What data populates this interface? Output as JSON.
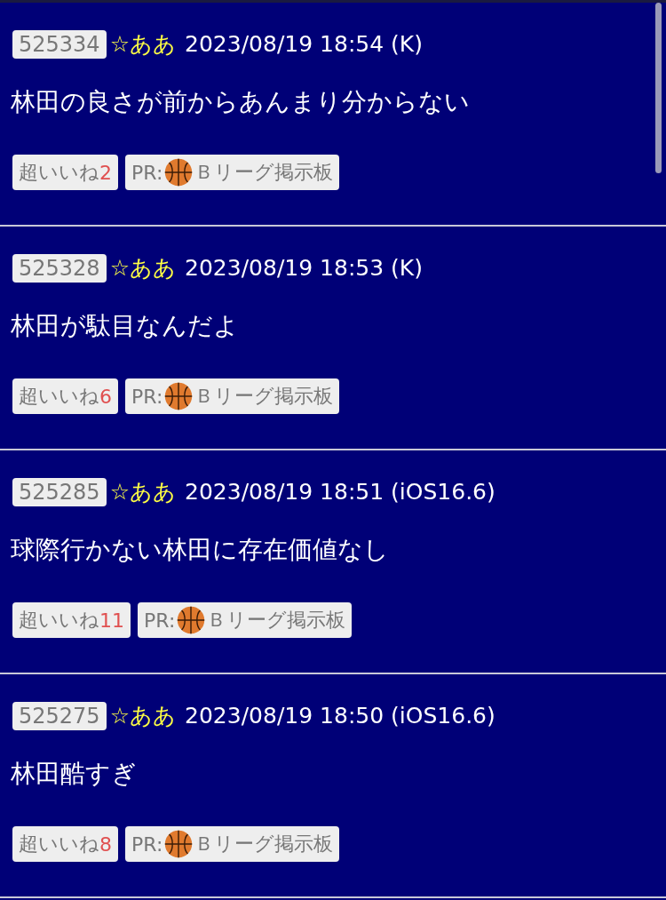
{
  "posts": [
    {
      "number": "525334",
      "name": "☆ああ",
      "date": "2023/08/19 18:54 (K)",
      "body": "林田の良さが前からあんまり分からない",
      "like_label": "超いいね",
      "like_count": "2",
      "pr_label": "PR:",
      "pr_board": "Ｂリーグ掲示板"
    },
    {
      "number": "525328",
      "name": "☆ああ",
      "date": "2023/08/19 18:53 (K)",
      "body": "林田が駄目なんだよ",
      "like_label": "超いいね",
      "like_count": "6",
      "pr_label": "PR:",
      "pr_board": "Ｂリーグ掲示板"
    },
    {
      "number": "525285",
      "name": "☆ああ",
      "date": "2023/08/19 18:51 (iOS16.6)",
      "body": "球際行かない林田に存在価値なし",
      "like_label": "超いいね",
      "like_count": "11",
      "pr_label": "PR:",
      "pr_board": "Ｂリーグ掲示板"
    },
    {
      "number": "525275",
      "name": "☆ああ",
      "date": "2023/08/19 18:50 (iOS16.6)",
      "body": "林田酷すぎ",
      "like_label": "超いいね",
      "like_count": "8",
      "pr_label": "PR:",
      "pr_board": "Ｂリーグ掲示板"
    }
  ]
}
